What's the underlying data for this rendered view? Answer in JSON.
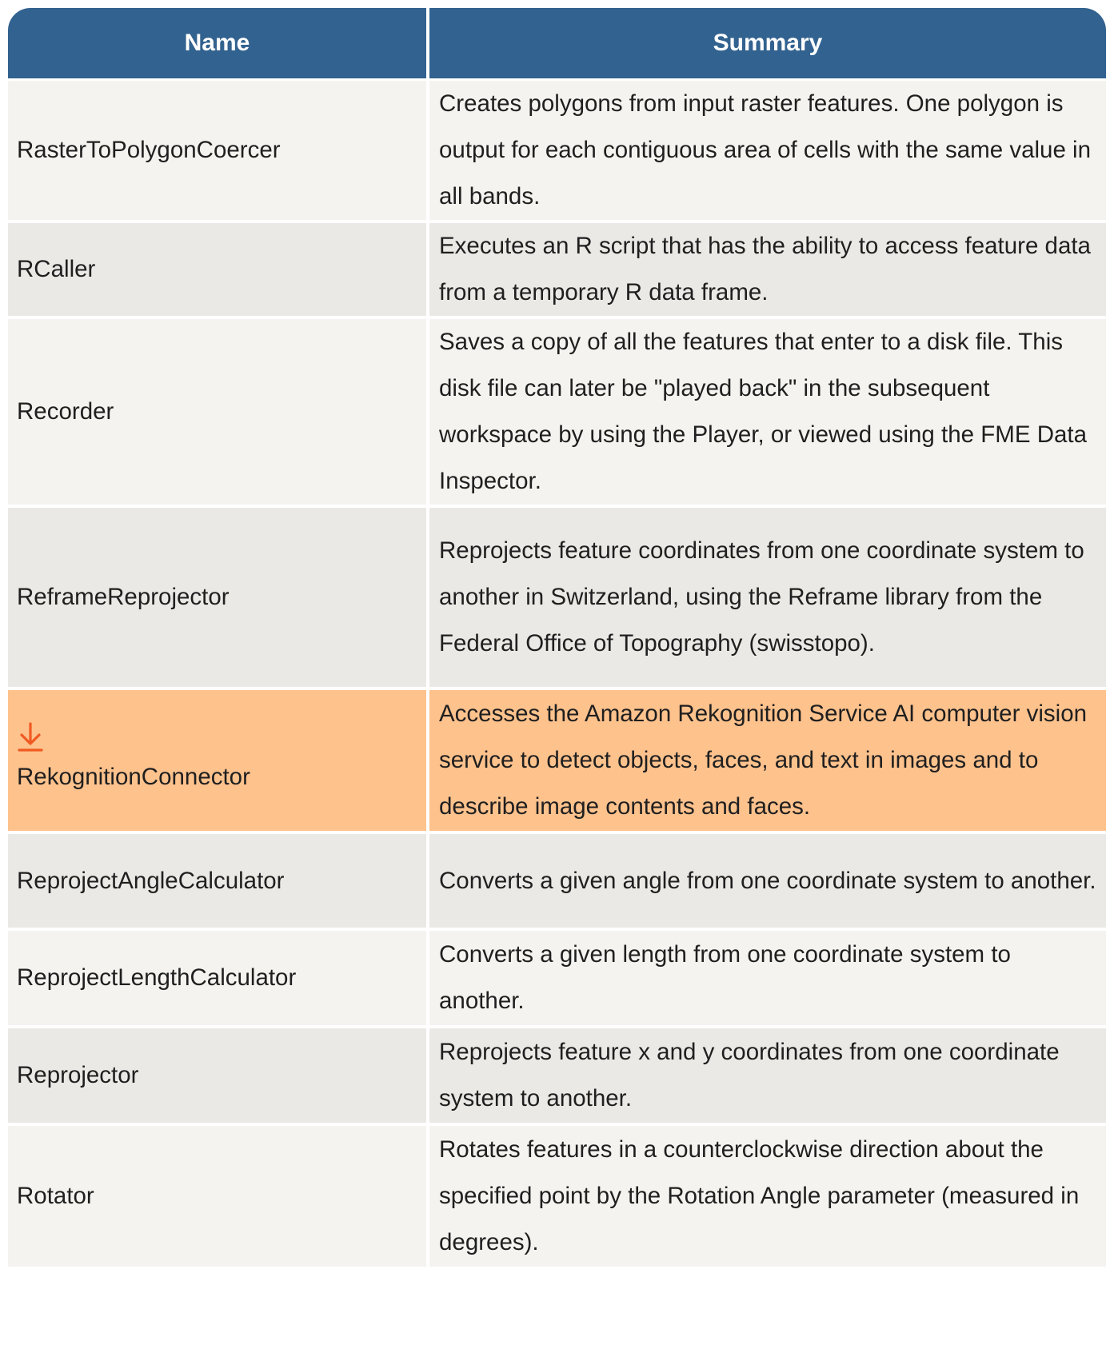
{
  "table": {
    "headers": {
      "name": "Name",
      "summary": "Summary"
    },
    "rows": [
      {
        "name": "RasterToPolygonCoercer",
        "summary": "Creates polygons from input raster features. One polygon is output for each contiguous area of cells with the same value in all bands."
      },
      {
        "name": "RCaller",
        "summary": "Executes an R script that has the ability to access feature data from a temporary R data frame."
      },
      {
        "name": "Recorder",
        "summary": "Saves a copy of all the features that enter to a disk file. This disk file can later be \"played back\" in the subsequent workspace by using the Player, or viewed using the FME Data Inspector."
      },
      {
        "name": "ReframeReprojector",
        "summary": "Reprojects feature coordinates from one coordinate system to another in Switzerland, using the Reframe library from the Federal Office of Topography (swisstopo)."
      },
      {
        "name": "RekognitionConnector",
        "summary": "Accesses the Amazon Rekognition Service AI computer vision service to detect objects, faces, and text in images and to describe image contents and faces.",
        "icon": "download-icon",
        "highlighted": true
      },
      {
        "name": "ReprojectAngleCalculator",
        "summary": "Converts a given angle from one coordinate system to another."
      },
      {
        "name": "ReprojectLengthCalculator",
        "summary": "Converts a given length from one coordinate system to another."
      },
      {
        "name": "Reprojector",
        "summary": "Reprojects feature x and y coordinates from one coordinate system to another."
      },
      {
        "name": "Rotator",
        "summary": "Rotates features in a counterclockwise direction about the specified point by the Rotation Angle parameter (measured in degrees)."
      }
    ]
  },
  "colors": {
    "header_bg": "#32628f",
    "row_odd": "#f4f3ef",
    "row_even": "#eae9e5",
    "row_highlight": "#fec28d",
    "icon_accent": "#f05a22"
  }
}
